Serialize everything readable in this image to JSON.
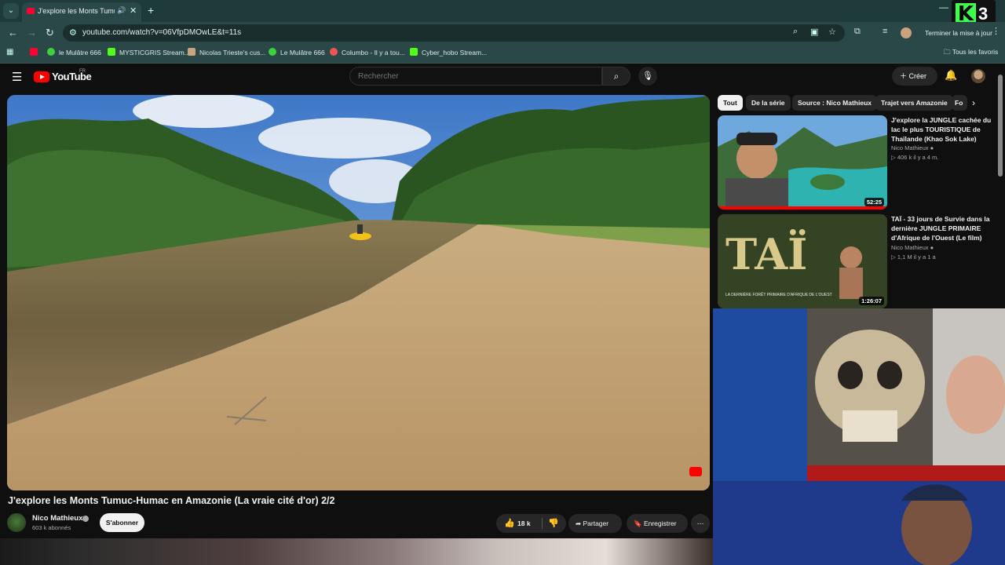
{
  "browser": {
    "tab_title": "J'explore les Monts Tumuc",
    "audio_icon": "speaker-icon",
    "close_glyph": "✕",
    "new_tab_glyph": "+",
    "url": "youtube.com/watch?v=06VfpDMOwLE&t=11s",
    "update_label": "Terminer la mise à jour",
    "bookmarks": [
      {
        "label": "",
        "color": "#ff0033"
      },
      {
        "label": "le Mulâtre 666",
        "color": "#3cd13c"
      },
      {
        "label": "MYSTICGRIS Stream...",
        "color": "#53fc18"
      },
      {
        "label": "Nicolas Trieste's cus...",
        "color": "#c9a27e"
      },
      {
        "label": "Le Mulâtre 666",
        "color": "#3cd13c"
      },
      {
        "label": "Columbo - Il y a tou...",
        "color": "#e55"
      },
      {
        "label": "Cyber_hobo Stream...",
        "color": "#53fc18"
      }
    ],
    "all_bookmarks": "Tous les favoris"
  },
  "overlay_logo": {
    "letter": "K",
    "digit": "3"
  },
  "youtube": {
    "wordmark": "YouTube",
    "region": "FR",
    "search_placeholder": "Rechercher",
    "create_label": "Créer",
    "video": {
      "title": "J'explore les Monts Tumuc-Humac en Amazonie (La vraie cité d'or) 2/2",
      "channel": "Nico Mathieux",
      "subscribers": "603 k abonnés",
      "subscribe_label": "S'abonner",
      "likes": "18 k",
      "share_label": "Partager",
      "save_label": "Enregistrer",
      "more_glyph": "⋯"
    },
    "chips": [
      "Tout",
      "De la série",
      "Source : Nico Mathieux",
      "Trajet vers Amazonie",
      "Fo"
    ],
    "recommendations": [
      {
        "title": "J'explore la JUNGLE cachée du lac le plus TOURISTIQUE de Thaïlande (Khao Sok Lake)",
        "channel": "Nico Mathieux",
        "meta": "406 k  il y a 4 m.",
        "duration": "52:25"
      },
      {
        "title": "TAÏ - 33 jours de Survie dans la dernière JUNGLE PRIMAIRE d'Afrique de l'Ouest (Le film)",
        "channel": "Nico Mathieux",
        "meta": "1,1 M  il y a 1 a",
        "duration": "1:26:07",
        "thumb_text": "TAÏ",
        "thumb_caption": "LA DERNIÈRE FORÊT PRIMAIRE D'AFRIQUE DE L'OUEST"
      }
    ]
  }
}
